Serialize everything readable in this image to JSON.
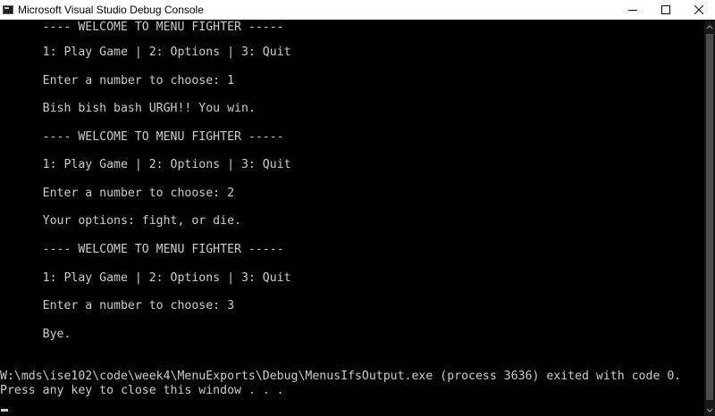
{
  "window": {
    "title": "Microsoft Visual Studio Debug Console",
    "app_icon": "console-icon",
    "controls": {
      "minimize_icon": "minimize-icon",
      "maximize_icon": "maximize-icon",
      "close_icon": "close-icon"
    }
  },
  "console": {
    "lines": [
      "      ---- WELCOME TO MENU FIGHTER -----",
      "      1: Play Game | 2: Options | 3: Quit",
      "      Enter a number to choose: 1",
      "      Bish bish bash URGH!! You win.",
      "      ---- WELCOME TO MENU FIGHTER -----",
      "      1: Play Game | 2: Options | 3: Quit",
      "      Enter a number to choose: 2",
      "      Your options: fight, or die.",
      "      ---- WELCOME TO MENU FIGHTER -----",
      "      1: Play Game | 2: Options | 3: Quit",
      "      Enter a number to choose: 3",
      "      Bye.",
      "W:\\mds\\ise102\\code\\week4\\MenuExports\\Debug\\MenusIfsOutput.exe (process 3636) exited with code 0.",
      "Press any key to close this window . . ."
    ],
    "text_color": "#cccccc",
    "background_color": "#000000"
  }
}
